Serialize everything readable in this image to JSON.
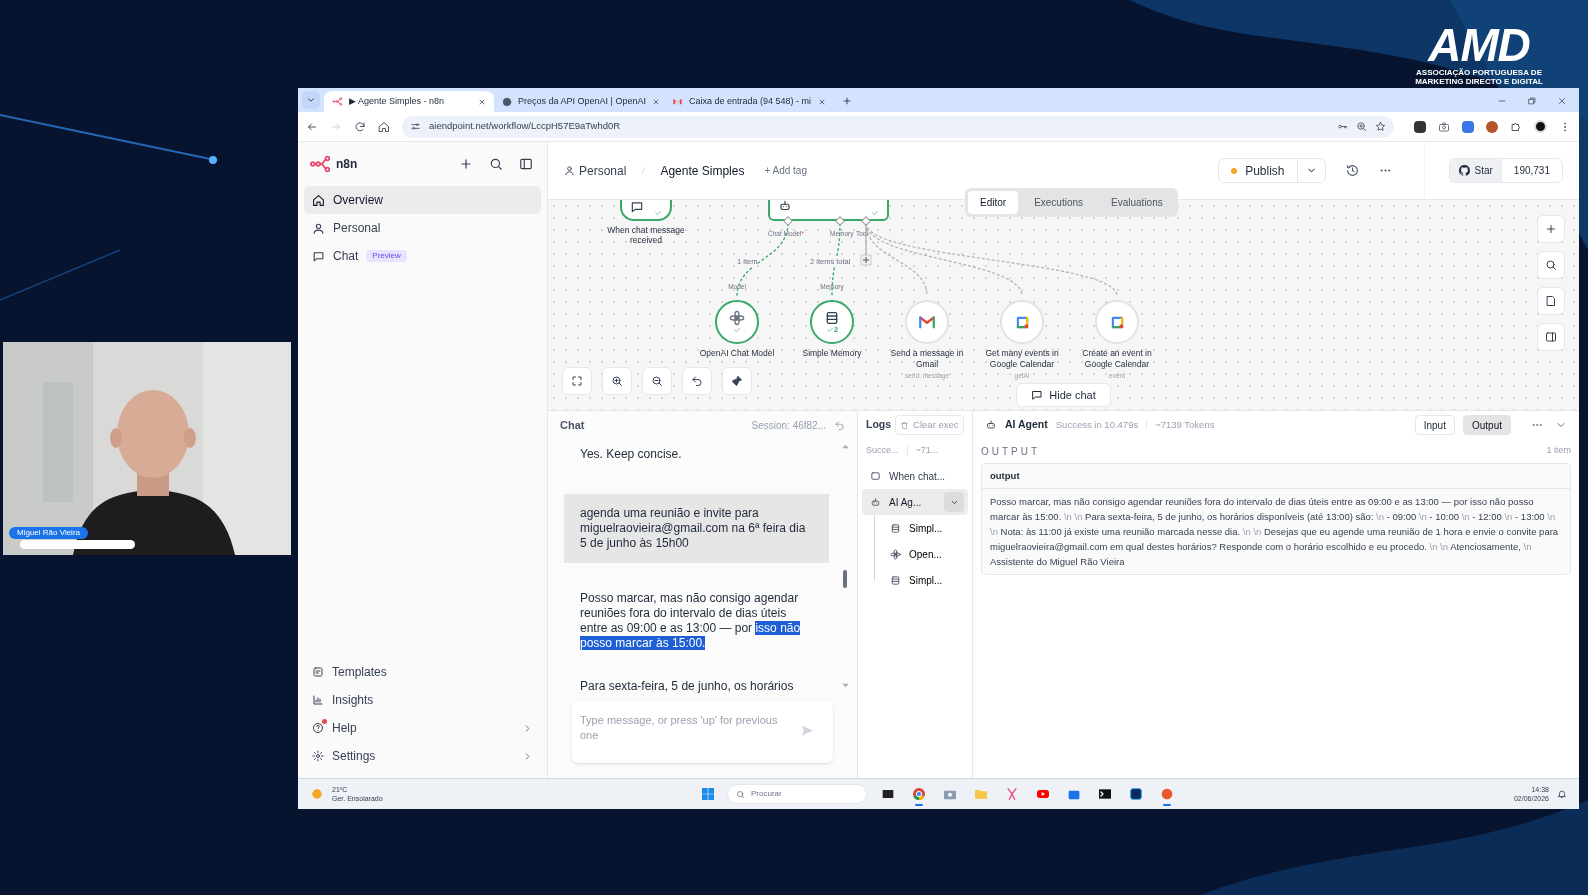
{
  "presentation": {
    "logo": {
      "wordmark": "AMD",
      "subtitle_lines": [
        "ASSOCIAÇÃO PORTUGUESA DE",
        "MARKETING DIRECTO E DIGITAL"
      ]
    },
    "webcam": {
      "kind": "picture",
      "name_caption": "Miguel Rão Vieira"
    }
  },
  "browser": {
    "tabs": [
      {
        "title": "▶ Agente Simples - n8n",
        "selected": true
      },
      {
        "title": "Preços da API OpenAI | OpenAI",
        "selected": false
      },
      {
        "title": "Caixa de entrada (94 548) - mi",
        "selected": false
      }
    ],
    "address": "aiendpoint.net/workflow/LccpH57E9aTwhd0R"
  },
  "sidebar": {
    "brand": "n8n",
    "items": [
      {
        "label": "Overview",
        "selected": true
      },
      {
        "label": "Personal",
        "selected": false
      },
      {
        "label": "Chat",
        "selected": false,
        "badge": "Preview"
      }
    ],
    "bottom_items": [
      {
        "label": "Templates",
        "notification": false,
        "submenu": false
      },
      {
        "label": "Insights",
        "notification": false,
        "submenu": false
      },
      {
        "label": "Help",
        "notification": true,
        "submenu": true
      },
      {
        "label": "Settings",
        "notification": false,
        "submenu": true
      }
    ]
  },
  "header": {
    "project": "Personal",
    "workflow": "Agente Simples",
    "add_tag": "+ Add tag",
    "publish": "Publish",
    "star": "Star",
    "star_count": "190,731"
  },
  "view_tabs": [
    {
      "label": "Editor",
      "selected": true
    },
    {
      "label": "Executions",
      "selected": false
    },
    {
      "label": "Evaluations",
      "selected": false
    }
  ],
  "canvas": {
    "trigger": {
      "label": "When chat message received",
      "done": true
    },
    "agent": {
      "done": true,
      "ports": [
        {
          "kind": "model",
          "label": "Chat Model",
          "marker": "*"
        },
        {
          "kind": "memory",
          "label": "Memory"
        },
        {
          "kind": "tool",
          "label": "Tool"
        }
      ]
    },
    "sub_nodes": [
      {
        "kind": "model",
        "label": "OpenAI Chat Model",
        "target_label": "Model",
        "edge_label": "1 item",
        "done": true
      },
      {
        "kind": "memory",
        "label": "Simple Memory",
        "target_label": "Memory",
        "edge_label": "2 items total",
        "done": true,
        "run_count": "2"
      },
      {
        "kind": "email",
        "label": "Send a message in Gmail",
        "subtitle": "send: message",
        "done": false
      },
      {
        "kind": "calendar",
        "label": "Get many events in Google Calendar",
        "subtitle": "getAl",
        "done": false
      },
      {
        "kind": "calendar",
        "label": "Create an event in Google Calendar",
        "subtitle": "event",
        "done": false
      }
    ],
    "hide_chat": "Hide chat"
  },
  "chat": {
    "title": "Chat",
    "session": "Session: 46f82...",
    "messages": [
      {
        "kind": "bot",
        "segments": [
          {
            "text": "Yes. Keep concise.",
            "selected": false
          }
        ]
      },
      {
        "kind": "user",
        "segments": [
          {
            "text": "agenda uma reunião e invite para miguelraovieira@gmail.com na 6ª feira dia 5 de junho às 15h00",
            "selected": false
          }
        ]
      },
      {
        "kind": "bot",
        "segments": [
          {
            "text": "Posso marcar, mas não consigo agendar reuniões fora do intervalo de dias úteis entre as 09:00 e as 13:00 — por ",
            "selected": false
          },
          {
            "text": "isso não posso marcar às 15:00.",
            "selected": true
          }
        ]
      },
      {
        "kind": "bot",
        "segments": [
          {
            "text": "Para sexta-feira, 5 de junho, os horários",
            "selected": false
          }
        ]
      }
    ],
    "placeholder": "Type message, or press 'up' for previous one"
  },
  "logs": {
    "title": "Logs",
    "clear": "Clear exec",
    "summary": [
      "Succe...",
      "~71..."
    ],
    "tree": [
      {
        "label": "When chat...",
        "kind": "chat",
        "selected": false
      },
      {
        "label": "AI Ag...",
        "kind": "agent",
        "selected": true,
        "expanded": true,
        "children": [
          {
            "label": "Simpl...",
            "kind": "memory",
            "selected": false
          },
          {
            "label": "Open...",
            "kind": "model",
            "selected": false
          },
          {
            "label": "Simpl...",
            "kind": "memory",
            "selected": false
          }
        ]
      }
    ]
  },
  "output": {
    "node": "AI Agent",
    "status": "Success in 10.479s",
    "tokens": "~7139 Tokens",
    "modes": [
      {
        "label": "Input",
        "selected": false
      },
      {
        "label": "Output",
        "selected": true
      }
    ],
    "section": "OUTPUT",
    "count": "1 item",
    "field": "output",
    "text": [
      {
        "kind": "text",
        "text": "Posso marcar, mas não consigo agendar reuniões fora do intervalo de dias úteis entre as 09:00 e as 13:00 — por isso não posso marcar às 15:00."
      },
      {
        "kind": "escape",
        "text": "\\n"
      },
      {
        "kind": "escape",
        "text": "\\n"
      },
      {
        "kind": "text",
        "text": "Para sexta-feira, 5 de junho, os horários disponíveis (até 13:00) são:"
      },
      {
        "kind": "escape",
        "text": "\\n"
      },
      {
        "kind": "text",
        "text": "- 09:00"
      },
      {
        "kind": "escape",
        "text": "\\n"
      },
      {
        "kind": "text",
        "text": "- 10:00"
      },
      {
        "kind": "escape",
        "text": "\\n"
      },
      {
        "kind": "text",
        "text": "- 12:00"
      },
      {
        "kind": "escape",
        "text": "\\n"
      },
      {
        "kind": "text",
        "text": "- 13:00"
      },
      {
        "kind": "escape",
        "text": "\\n"
      },
      {
        "kind": "escape",
        "text": "\\n"
      },
      {
        "kind": "text",
        "text": "Nota: às 11:00 já existe uma reunião marcada nesse dia."
      },
      {
        "kind": "escape",
        "text": "\\n"
      },
      {
        "kind": "escape",
        "text": "\\n"
      },
      {
        "kind": "text",
        "text": "Desejas que eu agende uma reunião de 1 hora e envie o convite para miguelraovieira@gmail.com em qual destes horários? Responde com o horário escolhido e eu procedo."
      },
      {
        "kind": "escape",
        "text": "\\n"
      },
      {
        "kind": "escape",
        "text": "\\n"
      },
      {
        "kind": "text",
        "text": "Atenciosamente,"
      },
      {
        "kind": "escape",
        "text": "\\n"
      },
      {
        "kind": "text",
        "text": "Assistente do Miguel Rão Vieira"
      }
    ]
  },
  "taskbar": {
    "weather_temp": "21ºC",
    "weather_desc": "Ger. Ensolarado",
    "search": "Procurar",
    "apps": [
      {
        "kind": "taskview",
        "active": false
      },
      {
        "kind": "chrome",
        "active": true
      },
      {
        "kind": "camera",
        "active": false
      },
      {
        "kind": "files",
        "active": false
      },
      {
        "kind": "snip",
        "active": false
      },
      {
        "kind": "youtube",
        "active": false
      },
      {
        "kind": "store",
        "active": false
      },
      {
        "kind": "terminal",
        "active": false
      },
      {
        "kind": "photoshop",
        "active": false
      },
      {
        "kind": "app",
        "active": true
      }
    ],
    "time": "14:38",
    "date": "02/06/2026"
  }
}
